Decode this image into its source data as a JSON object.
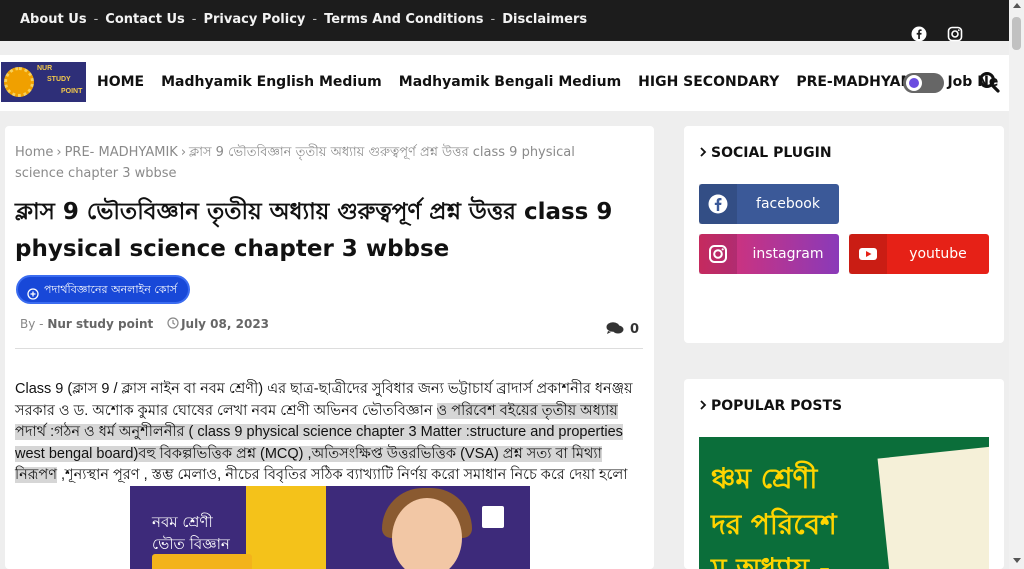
{
  "topbar": {
    "links": [
      "About Us",
      "Contact Us",
      "Privacy Policy",
      "Terms And Conditions",
      "Disclaimers"
    ],
    "separator": "-",
    "social_icons": [
      "facebook-icon",
      "instagram-icon"
    ]
  },
  "logo": {
    "line1": "NUR",
    "line2": "STUDY",
    "line3": "POINT"
  },
  "nav": {
    "items": [
      "HOME",
      "Madhyamik English Medium",
      "Madhyamik Bengali Medium",
      "HIGH SECONDARY",
      "PRE-MADHYAMIK",
      "Job Ne"
    ]
  },
  "breadcrumb": {
    "home": "Home",
    "category": "PRE- MADHYAMIK",
    "current": "ক্লাস 9 ভৌতবিজ্ঞান তৃতীয় অধ্যায় গুরুত্বপূর্ণ প্রশ্ন উত্তর class 9 physical science chapter 3 wbbse",
    "separator": "›"
  },
  "post": {
    "title": "ক্লাস 9 ভৌতবিজ্ঞান তৃতীয় অধ্যায় গুরুত্বপূর্ণ প্রশ্ন উত্তর class 9 physical science chapter 3 wbbse",
    "course_button": "পদার্থবিজ্ঞানের অনলাইন কোর্স",
    "author_prefix": "By -",
    "author": "Nur study point",
    "date": "July 08, 2023",
    "comment_count": "0",
    "paragraph_start": "Class 9 (ক্লাস 9 / ক্লাস নাইন বা নবম শ্রেণী) এর ছাত্র-ছাত্রীদের সুবিধার জন্য ভট্টাচার্য ব্রাদার্স প্রকাশনীর ধনঞ্জয় সরকার ও ড. অশোক কুমার ঘোষের লেখা নবম শ্রেণী অভিনব ভৌতবিজ্ঞান ",
    "paragraph_highlight": "ও পরিবেশ বইয়ের তৃতীয়  অধ্যায় পদার্থ :গঠন ও ধর্ম অনুশীলনীর ( class 9 physical science  chapter 3 Matter :structure and properties west bengal board)বহু বিকল্পভিত্তিক প্রশ্ন (MCQ) ,অতিসংক্ষিপ্ত উত্তরভিত্তিক (VSA) প্রশ্ন সত্য বা মিথ্যা নিরূপণ",
    "paragraph_end": "  ,শূন্যস্থান পূরণ , স্তম্ভ মেলাও, নীচের বিবৃতির সঠিক ব্যাখ্যাটি নির্ণয় করো সমাধান নিচে করে দেয়া হলো",
    "image_line1": "নবম শ্রেণী",
    "image_line2": "ভৌত বিজ্ঞান"
  },
  "sidebar": {
    "social_heading": "SOCIAL PLUGIN",
    "facebook": "facebook",
    "instagram": "instagram",
    "youtube": "youtube",
    "popular_heading": "POPULAR POSTS",
    "popular_img_line1": "ঞ্চম শ্রেণী",
    "popular_img_line2": "দর পরিবেশ",
    "popular_img_line3": "ম অধ্যায় -"
  },
  "colors": {
    "topbar_bg": "#1c1c1c",
    "accent_blue": "#1848d8",
    "facebook": "#3b5998",
    "youtube": "#e62117",
    "toggle_moon": "#6b4ce0"
  }
}
